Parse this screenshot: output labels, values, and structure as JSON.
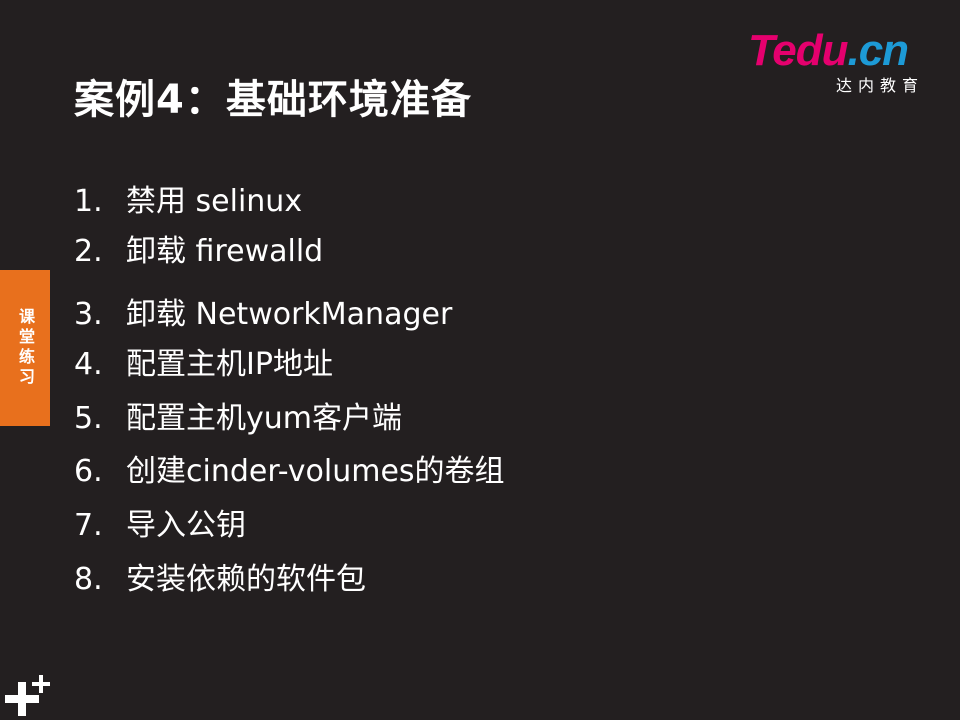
{
  "slide": {
    "title": "案例4：基础环境准备",
    "side_tab": "课堂练习",
    "items": [
      {
        "num": "1.",
        "text": "禁用 selinux"
      },
      {
        "num": "2.",
        "text": "卸载 firewalld"
      },
      {
        "num": "3.",
        "text": "卸载 NetworkManager"
      },
      {
        "num": "4.",
        "text": "配置主机IP地址"
      },
      {
        "num": "5.",
        "text": "配置主机yum客户端"
      },
      {
        "num": "6.",
        "text": "创建cinder-volumes的卷组"
      },
      {
        "num": "7.",
        "text": "导入公钥"
      },
      {
        "num": "8.",
        "text": "安装依赖的软件包"
      }
    ]
  },
  "logo": {
    "brand": "Tedu",
    "suffix": ".cn",
    "subtitle": "达内教育"
  },
  "colors": {
    "background": "#231f20",
    "accent_orange": "#e8701d",
    "logo_pink": "#e5006e",
    "logo_blue": "#1d9ad6",
    "text": "#ffffff"
  },
  "icons": {
    "corner": "plus-cluster-icon"
  }
}
